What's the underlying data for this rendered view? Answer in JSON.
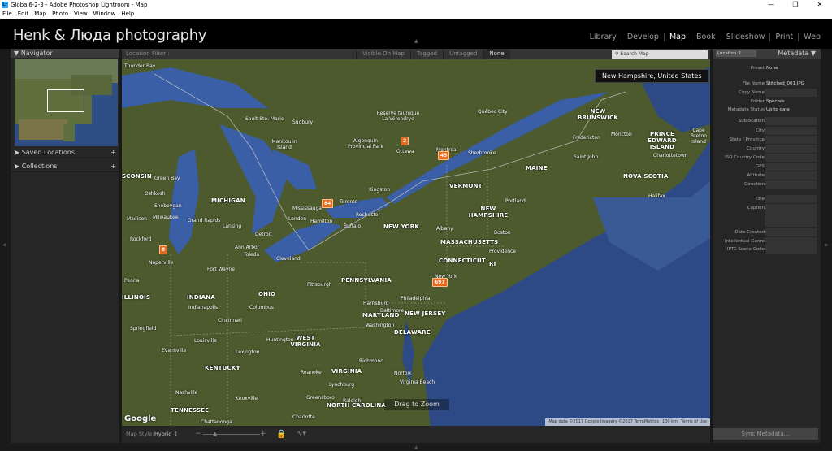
{
  "window": {
    "app_icon": "Lr",
    "title": "Global6-2-3 - Adobe Photoshop Lightroom - Map",
    "buttons": [
      "minimize-icon",
      "restore-icon",
      "close-icon"
    ]
  },
  "menu": [
    "File",
    "Edit",
    "Map",
    "Photo",
    "View",
    "Window",
    "Help"
  ],
  "identity_plate": "Henk & Люда photography",
  "modules": [
    "Library",
    "Develop",
    "Map",
    "Book",
    "Slideshow",
    "Print",
    "Web"
  ],
  "active_module": "Map",
  "navigator": {
    "title": "Navigator"
  },
  "left_sections": [
    {
      "label": "Saved Locations",
      "plus": "+"
    },
    {
      "label": "Collections",
      "plus": "+"
    }
  ],
  "location_filter": {
    "label": "Location Filter :",
    "options": [
      "Visible On Map",
      "Tagged",
      "Untagged",
      "None"
    ],
    "selected": "None"
  },
  "search_map": {
    "placeholder": "Search Map"
  },
  "tooltip": "New Hampshire, United States",
  "map_labels": {
    "states": [
      "MICHIGAN",
      "OHIO",
      "INDIANA",
      "ILLINOIS",
      "KENTUCKY",
      "TENNESSEE",
      "WEST VIRGINIA",
      "VIRGINIA",
      "NORTH CAROLINA",
      "PENNSYLVANIA",
      "NEW YORK",
      "VERMONT",
      "NEW HAMPSHIRE",
      "MAINE",
      "MASSACHUSETTS",
      "CONNECTICUT",
      "RI",
      "NEW JERSEY",
      "MARYLAND",
      "DELAWARE",
      "NEW BRUNSWICK",
      "PRINCE EDWARD ISLAND",
      "NOVA SCOTIA",
      "SCONSIN"
    ],
    "cities": [
      "Thunder Bay",
      "Sudbury",
      "Ottawa",
      "Montreal",
      "Québec City",
      "Sherbrooke",
      "Kingston",
      "Toronto",
      "Mississauga",
      "Hamilton",
      "Buffalo",
      "Rochester",
      "Detroit",
      "London",
      "Toledo",
      "Cleveland",
      "Pittsburgh",
      "Columbus",
      "Cincinnati",
      "Indianapolis",
      "Louisville",
      "Nashville",
      "Chattanooga",
      "Knoxville",
      "Charlotte",
      "Raleigh",
      "Greensboro",
      "Richmond",
      "Roanoke",
      "Washington",
      "Baltimore",
      "Philadelphia",
      "New York",
      "Providence",
      "Boston",
      "Albany",
      "Portland",
      "Saint John",
      "Fredericton",
      "Moncton",
      "Charlottetown",
      "Halifax",
      "Milwaukee",
      "Madison",
      "Rockford",
      "Naperville",
      "Grand Rapids",
      "Lansing",
      "Ann Arbor",
      "Fort Wayne",
      "Peoria",
      "Evansville",
      "Lexington",
      "Huntington",
      "Lynchburg",
      "Virginia Beach",
      "Norfolk",
      "Harrisburg",
      "Algonquin Provincial Park",
      "Réserve faunique La Vérendrye",
      "Sault Ste. Marie",
      "Manitoulin Island",
      "Green Bay",
      "Oshkosh",
      "Sheboygan",
      "Springfield",
      "Cape Breton Island"
    ]
  },
  "pins": [
    "2",
    "45",
    "84",
    "8",
    "697"
  ],
  "map_footer": {
    "google": "Google",
    "drag_hint": "Drag to Zoom",
    "attribution": [
      "Map data ©2017 Google Imagery ©2017 TerraMetrics",
      "100 km",
      "Terms of Use"
    ]
  },
  "map_toolbar": {
    "style_label": "Map Style:",
    "style_value": "Hybrid",
    "zoom_minus": "−",
    "zoom_plus": "+"
  },
  "metadata": {
    "preset_dropdown": "Location",
    "title": "Metadata",
    "fields": [
      {
        "k": "Preset",
        "v": "None"
      },
      {
        "k": "File Name",
        "v": "Stitched_001.JPG"
      },
      {
        "k": "Copy Name",
        "v": ""
      },
      {
        "k": "Folder",
        "v": "Specials"
      },
      {
        "k": "Metadata Status",
        "v": "Up to date"
      },
      {
        "k": "Sublocation",
        "v": ""
      },
      {
        "k": "City",
        "v": ""
      },
      {
        "k": "State / Province",
        "v": ""
      },
      {
        "k": "Country",
        "v": ""
      },
      {
        "k": "ISO Country Code",
        "v": ""
      },
      {
        "k": "GPS",
        "v": ""
      },
      {
        "k": "Altitude",
        "v": ""
      },
      {
        "k": "Direction",
        "v": ""
      },
      {
        "k": "Title",
        "v": ""
      },
      {
        "k": "Caption",
        "v": ""
      },
      {
        "k": "Date Created",
        "v": ""
      },
      {
        "k": "Intellectual Genre",
        "v": ""
      },
      {
        "k": "IPTC Scene Code",
        "v": ""
      }
    ]
  },
  "sync_button": "Sync Metadata..."
}
